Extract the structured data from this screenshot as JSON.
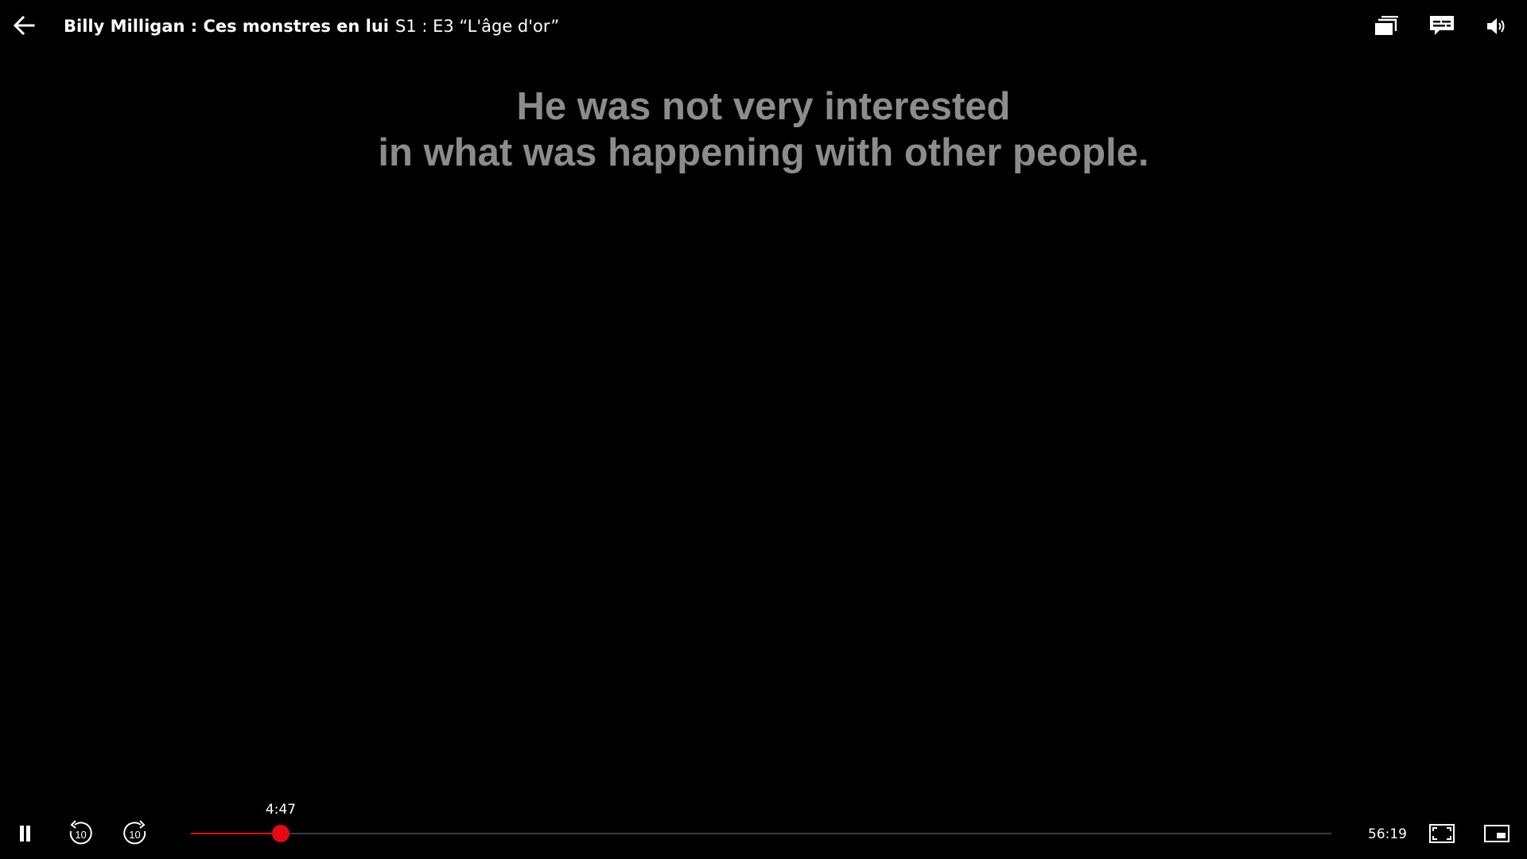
{
  "header": {
    "show_title": "Billy Milligan : Ces monstres en lui",
    "episode_title": "S1 : E3 “L'âge d'or”"
  },
  "subtitle": {
    "lines": [
      "He was not very interested",
      "in what was happening with other people."
    ]
  },
  "playback": {
    "current_time": "4:47",
    "total_time": "56:19",
    "progress_fraction": 0.0787,
    "accent_color": "#e50914"
  },
  "icons": {
    "back": "arrow-left-icon",
    "episodes": "episodes-stack-icon",
    "subtitles": "subtitles-icon",
    "volume": "volume-icon",
    "pause": "pause-icon",
    "rewind": "rewind-10-icon",
    "forward": "forward-10-icon",
    "fullscreen": "fullscreen-icon",
    "pip": "picture-in-picture-icon"
  }
}
